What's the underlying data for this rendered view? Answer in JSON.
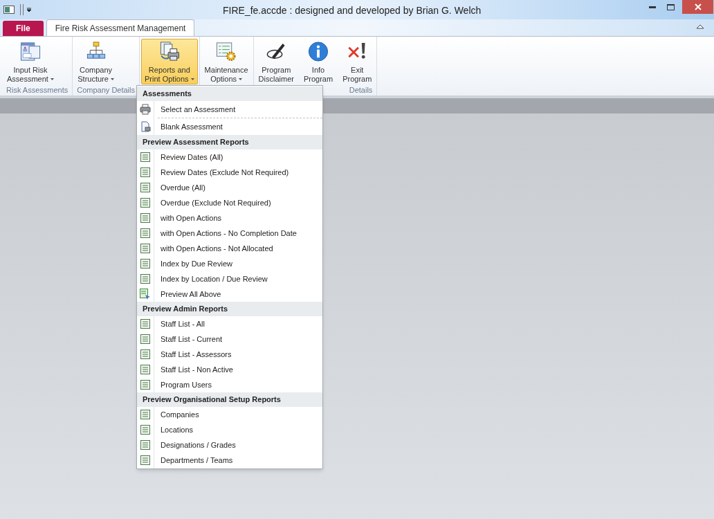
{
  "window": {
    "title": "FIRE_fe.accde : designed and developed by Brian G. Welch"
  },
  "tabs": [
    {
      "label": "File",
      "kind": "file",
      "selected": false
    },
    {
      "label": "Fire Risk Assessment Management",
      "kind": "tab",
      "selected": true
    }
  ],
  "ribbon": {
    "groups": [
      {
        "label": "Risk Assessments",
        "buttons": [
          {
            "lines": [
              "Input Risk",
              "Assessment"
            ],
            "kind": "form",
            "dropdown": true,
            "selected": false
          }
        ]
      },
      {
        "label": "Company Details",
        "buttons": [
          {
            "lines": [
              "Company",
              "Structure"
            ],
            "kind": "org",
            "dropdown": true,
            "selected": false
          }
        ]
      },
      {
        "buttons": [
          {
            "lines": [
              "Reports and",
              "Print Options"
            ],
            "kind": "reports",
            "dropdown": true,
            "selected": true
          }
        ]
      },
      {
        "buttons": [
          {
            "lines": [
              "Maintenance",
              "Options"
            ],
            "kind": "maint",
            "dropdown": true,
            "selected": false
          }
        ]
      },
      {
        "label": "Details",
        "buttons": [
          {
            "lines": [
              "Program",
              "Disclaimer"
            ],
            "kind": "pen",
            "dropdown": false,
            "selected": false
          },
          {
            "lines": [
              "Info",
              "Program"
            ],
            "kind": "info",
            "dropdown": false,
            "selected": false
          },
          {
            "lines": [
              "Exit",
              "Program"
            ],
            "kind": "exit",
            "dropdown": false,
            "selected": false
          }
        ]
      }
    ]
  },
  "menu": {
    "sections": [
      {
        "header": "Assessments",
        "items": [
          {
            "label": "Select an Assessment",
            "kind": "printer"
          },
          {
            "label": "Blank Assessment",
            "kind": "blank"
          }
        ]
      },
      {
        "header": "Preview Assessment Reports",
        "items": [
          {
            "label": "Review Dates (All)",
            "kind": "report"
          },
          {
            "label": "Review Dates (Exclude Not Required)",
            "kind": "report"
          },
          {
            "label": "Overdue (All)",
            "kind": "report"
          },
          {
            "label": "Overdue (Exclude Not Required)",
            "kind": "report"
          },
          {
            "label": "with Open Actions",
            "kind": "report"
          },
          {
            "label": "with Open Actions - No Completion Date",
            "kind": "report"
          },
          {
            "label": "with Open Actions - Not Allocated",
            "kind": "report"
          },
          {
            "label": "Index by Due Review",
            "kind": "report"
          },
          {
            "label": "Index by Location / Due Review",
            "kind": "report"
          },
          {
            "label": "Preview All Above",
            "kind": "preview"
          }
        ]
      },
      {
        "header": "Preview Admin Reports",
        "items": [
          {
            "label": "Staff List - All",
            "kind": "report"
          },
          {
            "label": "Staff List - Current",
            "kind": "report"
          },
          {
            "label": "Staff List - Assessors",
            "kind": "report"
          },
          {
            "label": "Staff List - Non Active",
            "kind": "report"
          },
          {
            "label": "Program Users",
            "kind": "report"
          }
        ]
      },
      {
        "header": "Preview Organisational Setup Reports",
        "items": [
          {
            "label": "Companies",
            "kind": "report"
          },
          {
            "label": "Locations",
            "kind": "report"
          },
          {
            "label": "Designations / Grades",
            "kind": "report"
          },
          {
            "label": "Departments / Teams",
            "kind": "report"
          }
        ]
      }
    ]
  }
}
